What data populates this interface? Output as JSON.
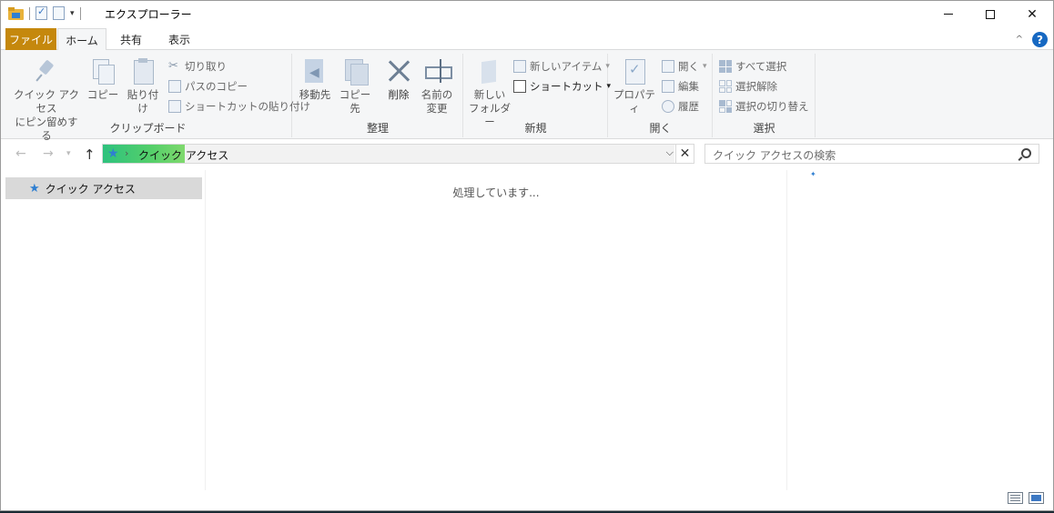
{
  "titlebar": {
    "title": "エクスプローラー",
    "minimize": "",
    "maximize": "",
    "close": "✕"
  },
  "tabs": {
    "file": "ファイル",
    "home": "ホーム",
    "share": "共有",
    "view": "表示"
  },
  "ribbon": {
    "clipboard": {
      "label": "クリップボード",
      "pin_line1": "クイック アクセス",
      "pin_line2": "にピン留めする",
      "copy": "コピー",
      "paste": "貼り付け",
      "cut": "切り取り",
      "copy_path": "パスのコピー",
      "paste_shortcut": "ショートカットの貼り付け"
    },
    "organize": {
      "label": "整理",
      "move_to": "移動先",
      "copy_to": "コピー先",
      "delete": "削除",
      "rename_line1": "名前の",
      "rename_line2": "変更"
    },
    "new": {
      "label": "新規",
      "new_folder_line1": "新しい",
      "new_folder_line2": "フォルダー",
      "new_item": "新しいアイテム",
      "shortcut": "ショートカット"
    },
    "open": {
      "label": "開く",
      "properties": "プロパティ",
      "open": "開く",
      "edit": "編集",
      "history": "履歴"
    },
    "select": {
      "label": "選択",
      "select_all": "すべて選択",
      "select_none": "選択解除",
      "invert": "選択の切り替え"
    }
  },
  "address": {
    "path": "クイック アクセス",
    "search_placeholder": "クイック アクセスの検索"
  },
  "navpane": {
    "quick_access": "クイック アクセス"
  },
  "content": {
    "status_message": "処理しています..."
  },
  "colors": {
    "file_tab": "#c5880d",
    "accent_blue": "#2f7fd1",
    "address_highlight": "#2ec27e"
  }
}
